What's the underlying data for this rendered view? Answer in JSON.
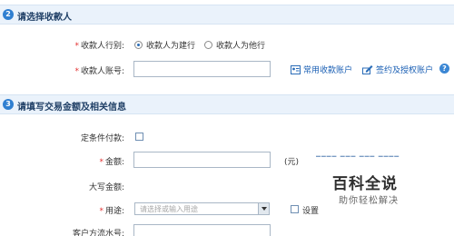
{
  "section_payee": {
    "step": "2",
    "title": "请选择收款人",
    "bank_label": "收款人行别:",
    "bank_options": [
      "收款人为建行",
      "收款人为他行"
    ],
    "bank_selected": 0,
    "account_label": "收款人账号:",
    "account_value": "",
    "link_common": "常用收款账户",
    "link_sign": "签约及授权账户",
    "help": "?"
  },
  "section_amount": {
    "step": "3",
    "title": "请填写交易金额及相关信息",
    "conditional_label": "定条件付款:",
    "amount_label": "金额:",
    "amount_value": "",
    "amount_unit": "(元)",
    "uppercase_label": "大写金额:",
    "purpose_label": "用途:",
    "purpose_placeholder": "请选择或输入用途",
    "purpose_setting": "设置",
    "serial_label": "客户方流水号:"
  },
  "required_mark": "*",
  "watermark": {
    "title": "百科全说",
    "subtitle": "助你轻松解决"
  },
  "colors": {
    "accent": "#2f7fd1",
    "required": "#e33131",
    "link": "#1a5fb4",
    "section_bg": "#eaf2fb"
  }
}
